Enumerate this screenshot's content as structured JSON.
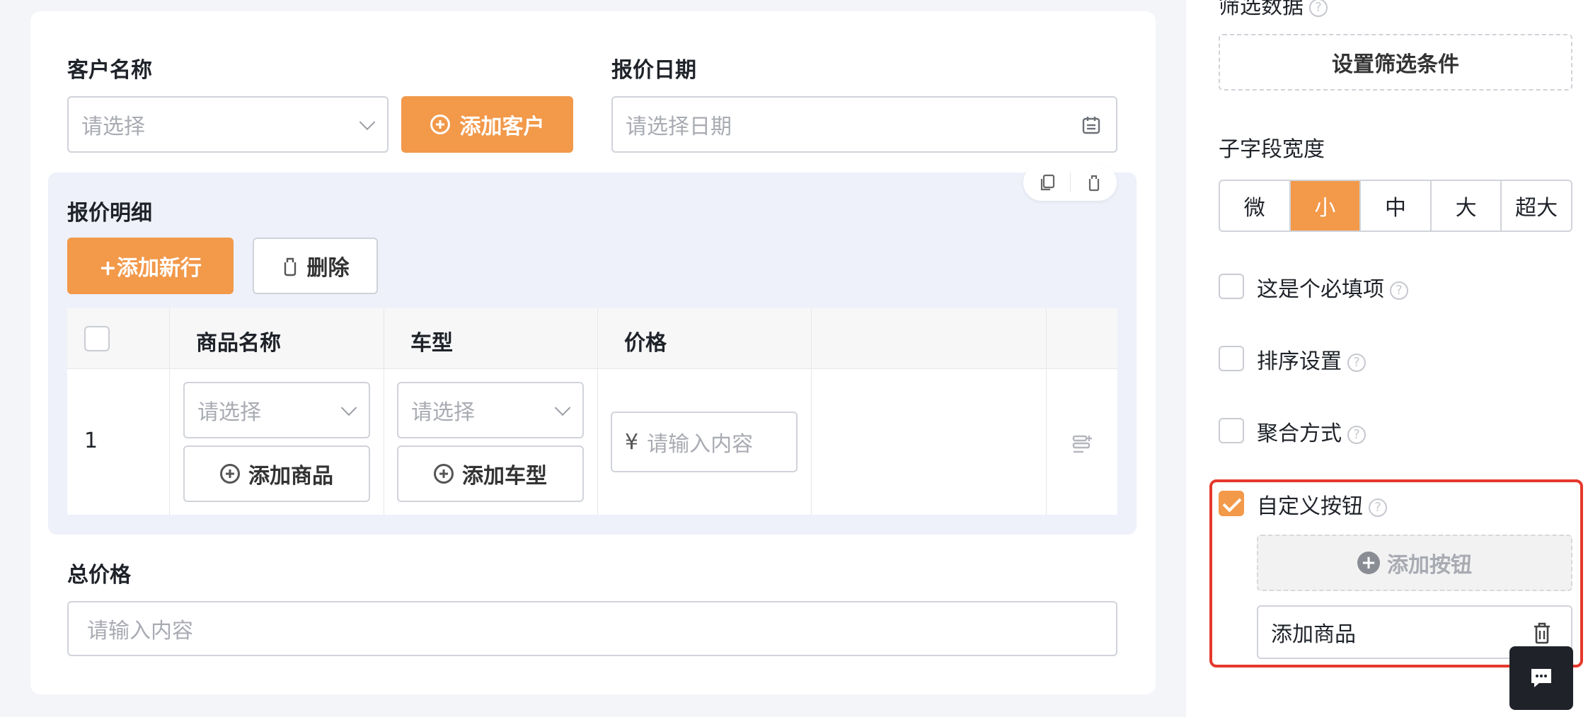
{
  "form": {
    "customer_label": "客户名称",
    "customer_placeholder": "请选择",
    "add_customer": "添加客户",
    "quote_date_label": "报价日期",
    "quote_date_placeholder": "请选择日期",
    "detail_title": "报价明细",
    "add_row": "+添加新行",
    "delete": "删除",
    "table": {
      "headers": [
        "商品名称",
        "车型",
        "价格"
      ],
      "row_index": "1",
      "product_placeholder": "请选择",
      "add_product": "添加商品",
      "car_placeholder": "请选择",
      "add_car": "添加车型",
      "currency": "¥",
      "price_placeholder": "请输入内容"
    },
    "total_label": "总价格",
    "total_placeholder": "请输入内容"
  },
  "sidebar": {
    "filter_title_partial": "筛选数据",
    "set_filter": "设置筛选条件",
    "width_title": "子字段宽度",
    "width_options": [
      "微",
      "小",
      "中",
      "大",
      "超大"
    ],
    "width_selected": "小",
    "options": {
      "required": "这是个必填项",
      "sort": "排序设置",
      "aggregate": "聚合方式",
      "custom_button": "自定义按钮"
    },
    "custom_button_checked": true,
    "add_button": "添加按钮",
    "custom_button_item": "添加商品",
    "help_glyph": "?"
  },
  "colors": {
    "accent": "#f2994a",
    "highlight_frame": "#e5382c",
    "panel_bg": "#eef0fa"
  }
}
